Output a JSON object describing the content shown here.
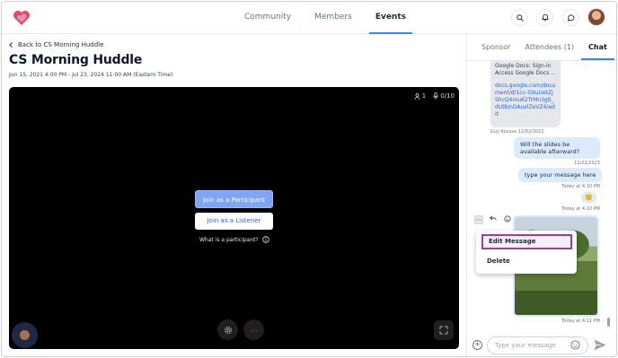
{
  "nav": {
    "links": [
      "Community",
      "Members",
      "Events"
    ],
    "active": "Events",
    "icons": [
      "search-icon",
      "bell-icon",
      "chat-bubble-icon"
    ]
  },
  "event": {
    "back_label": "Back to CS Morning Huddle",
    "title": "CS Morning Huddle",
    "dates": "Jun 15, 2021 4:00 PM - Jul 23, 2024 11:00 AM (Eastern Time)"
  },
  "stage": {
    "participants_count": "1",
    "mic_count": "0/10",
    "join_participant_label": "Join as a Participant",
    "join_listener_label": "Join as a Listener",
    "what_is_label": "What is a participant?",
    "colors": {
      "primary_button": "#7ea6f4",
      "stage_bg": "#000000"
    }
  },
  "sidebar": {
    "tabs": [
      "Sponsor",
      "Attendees (1)",
      "Chat"
    ],
    "active_tab": "Chat"
  },
  "chat": {
    "messages": [
      {
        "from": "other",
        "text": "Google Docs: Sign-in Access Google Docs ...",
        "link": "docs.google.com/document/d/1cc-G9uUetZjShcQ4muK2TrMn3gS_dUtbinDAuxlZeVZ4/edit",
        "author": "Guy Koussa",
        "date": "12/02/2022"
      },
      {
        "from": "me",
        "text": "Will the slides be available afterward?",
        "time": "11/22/2023"
      },
      {
        "from": "me",
        "text": "type your message here",
        "time": "Today at 4:10 PM"
      },
      {
        "from": "me",
        "emoji": "🙂",
        "time": "Today at 4:10 PM"
      },
      {
        "from": "me",
        "attachment": "photo",
        "time": "Today at 4:11 PM"
      }
    ],
    "context_menu": {
      "edit_label": "Edit Message",
      "delete_label": "Delete"
    },
    "composer_placeholder": "Type your message"
  }
}
